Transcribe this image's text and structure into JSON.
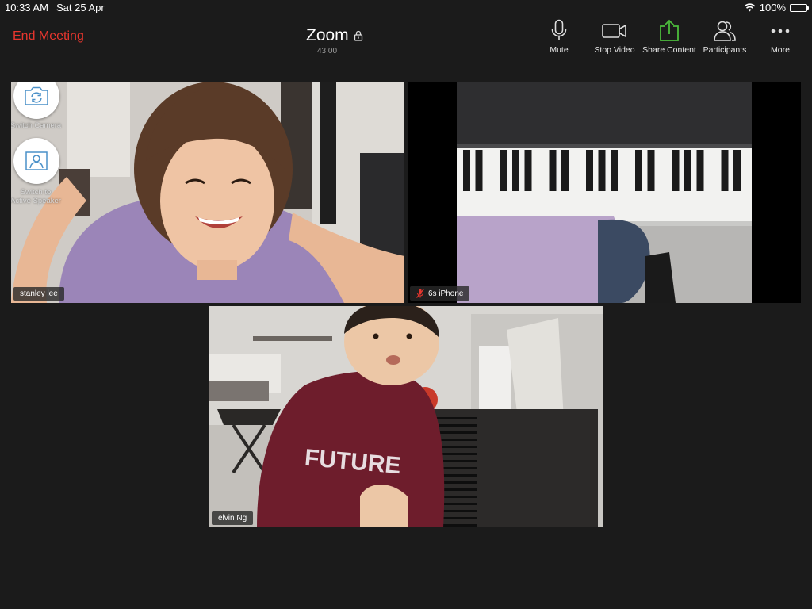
{
  "status_bar": {
    "time": "10:33 AM",
    "date": "Sat 25 Apr",
    "battery_text": "100%",
    "battery_level": 1.0
  },
  "toolbar": {
    "end_meeting": "End Meeting",
    "title": "Zoom",
    "duration": "43:00",
    "mute": "Mute",
    "stop_video": "Stop Video",
    "share_content": "Share Content",
    "participants": "Participants",
    "more": "More"
  },
  "floating": {
    "switch_camera": "Switch Camera",
    "switch_speaker_line1": "Switch to",
    "switch_speaker_line2": "Active Speaker"
  },
  "participants": [
    {
      "name": "stanley lee",
      "muted": false,
      "active": true
    },
    {
      "name": "6s iPhone",
      "muted": true,
      "active": false
    },
    {
      "name": "elvin Ng",
      "muted": false,
      "active": false
    }
  ],
  "colors": {
    "end_meeting": "#e8362e",
    "share_icon": "#4cbc3c",
    "active_border": "#7cc444",
    "background": "#1b1b1b"
  }
}
